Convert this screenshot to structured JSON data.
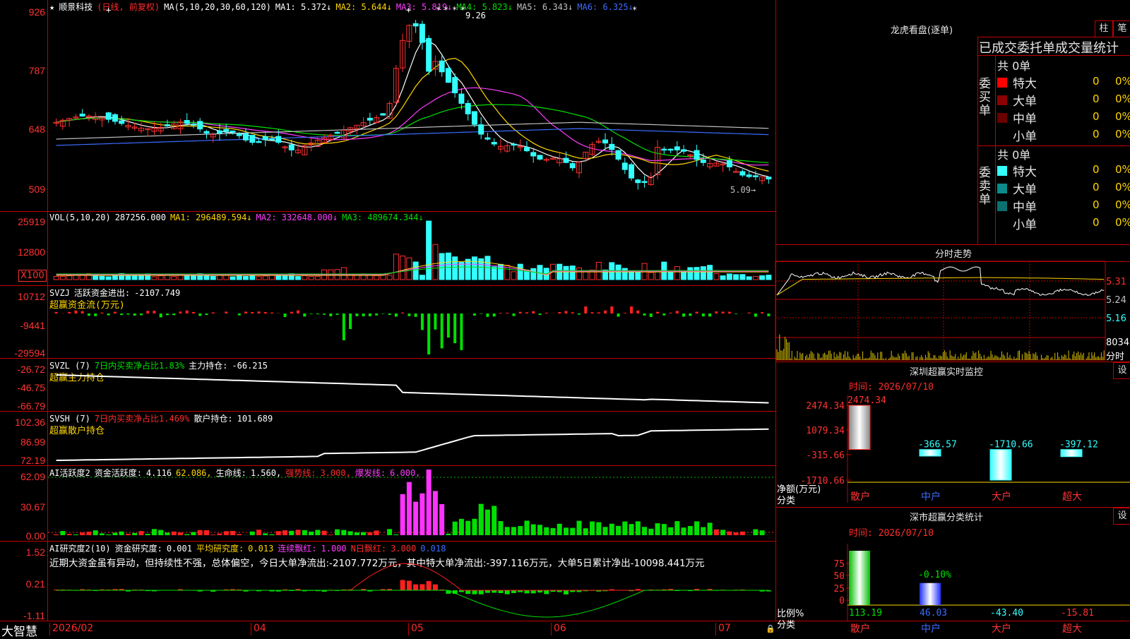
{
  "stock": {
    "name": "顺景科技",
    "period": "(日线, 前复权)",
    "ma_label": "MA(5,10,20,30,60,120)",
    "ma": [
      {
        "label": "MA1:",
        "value": "5.372",
        "arrow": "↓",
        "color": "#ffffff"
      },
      {
        "label": "MA2:",
        "value": "5.644",
        "arrow": "↓",
        "color": "#ffd700"
      },
      {
        "label": "MA3:",
        "value": "5.819",
        "arrow": "↓",
        "color": "#ff3cff"
      },
      {
        "label": "MA4:",
        "value": "5.823",
        "arrow": "↓",
        "color": "#00e000"
      },
      {
        "label": "MA5:",
        "value": "6.343",
        "arrow": "↓",
        "color": "#c0c0c0"
      },
      {
        "label": "MA6:",
        "value": "6.325",
        "arrow": "↓",
        "color": "#3b6cff"
      }
    ],
    "price_axis": [
      "926",
      "787",
      "648",
      "509"
    ],
    "high_label": "9.26",
    "low_label": "5.09"
  },
  "vol": {
    "label": "VOL(5,10,20)",
    "value": "287256.000",
    "ma": [
      {
        "label": "MA1:",
        "value": "296489.594",
        "arrow": "↓",
        "color": "#ffd700"
      },
      {
        "label": "MA2:",
        "value": "332648.000",
        "arrow": "↓",
        "color": "#ff3cff"
      },
      {
        "label": "MA3:",
        "value": "489674.344",
        "arrow": "↓",
        "color": "#00e000"
      }
    ],
    "axis": [
      "25919",
      "12800"
    ],
    "unit": "X100"
  },
  "svzj": {
    "label": "SVZJ",
    "desc": "活跃资金进出:",
    "value": "-2107.749",
    "sub": "超赢资金流(万元)",
    "axis": [
      "10712",
      "-9441",
      "-29594"
    ]
  },
  "svzl": {
    "label": "SVZL (7)",
    "desc": "7日内买卖净占比1.83%",
    "desc2": "主力持仓:",
    "value": "-66.215",
    "sub": "超赢主力持仓",
    "axis": [
      "-26.72",
      "-46.75",
      "-66.79"
    ]
  },
  "svsh": {
    "label": "SVSH (7)",
    "desc": "7日内买卖净占比1.469%",
    "desc2": "散户持仓:",
    "value": "101.689",
    "sub": "超赢散户持仓",
    "axis": [
      "102.36",
      "86.99",
      "72.19"
    ]
  },
  "ai_act": {
    "label": "AI活跃度2",
    "d1": "资金活跃度:",
    "v1": "4.116",
    "v2": "62.086,",
    "d3": "生命线:",
    "v3": "1.560,",
    "d4": "强势线:",
    "v4": "3.000,",
    "d5": "爆发线:",
    "v5": "6.000,",
    "axis": [
      "62.09",
      "30.67",
      "0.00"
    ]
  },
  "ai_res": {
    "label": "AI研究度2(10)",
    "d1": "资金研究度:",
    "v1": "0.001",
    "d2": "平均研究度:",
    "v2": "0.013",
    "d3": "连续飘红:",
    "v3": "1.000",
    "d4": "N日飘红:",
    "v4": "3.000",
    "v5": "0.018",
    "comment": "近期大资金虽有异动，但持续性不强，总体偏空，今日大单净流出:-2107.772万元，其中特大单净流出:-397.116万元，大单5日累计净出-10098.441万元",
    "axis": [
      "1.52",
      "0.21",
      "-1.11"
    ]
  },
  "xaxis": {
    "brand": "大智慧",
    "labels": [
      "2026/02",
      "04",
      "05",
      "06",
      "07"
    ]
  },
  "right": {
    "lhb_title": "龙虎看盘(逐单)",
    "btn_zhu": "柱",
    "btn_bi": "笔",
    "stat_title": "已成交委托单成交量统计",
    "buy_side": "委买单",
    "sell_side": "委卖单",
    "buy_total": "共 0单",
    "sell_total": "共 0单",
    "buy_rows": [
      {
        "name": "特大",
        "vol": "0",
        "pct": "0%",
        "color": "#ff0000"
      },
      {
        "name": "大单",
        "vol": "0",
        "pct": "0%",
        "color": "#8b0000"
      },
      {
        "name": "中单",
        "vol": "0",
        "pct": "0%",
        "color": "#6b0000"
      },
      {
        "name": "小单",
        "vol": "0",
        "pct": "0%",
        "color": ""
      }
    ],
    "sell_rows": [
      {
        "name": "特大",
        "vol": "0",
        "pct": "0%",
        "color": "#33ffff"
      },
      {
        "name": "大单",
        "vol": "0",
        "pct": "0%",
        "color": "#0b8b8b"
      },
      {
        "name": "中单",
        "vol": "0",
        "pct": "0%",
        "color": "#0b7070"
      },
      {
        "name": "小单",
        "vol": "0",
        "pct": "0%",
        "color": ""
      }
    ],
    "intraday_title": "分时走势",
    "intraday_axis": [
      "5.31",
      "5.24",
      "5.16"
    ],
    "intraday_vol": "8034",
    "intraday_unit": "分时",
    "sz_title": "深圳超赢实时监控",
    "sz_btn": "设",
    "sz_time": "时间: 2026/07/10",
    "sz_axis": [
      "2474.34",
      "1079.34",
      "-315.66",
      "-1710.66"
    ],
    "sz_unit": "净额(万元)",
    "sz_cat_label": "分类",
    "sz_bars": [
      {
        "cat": "散户",
        "value": 2474.34,
        "label": "2474.34"
      },
      {
        "cat": "中户",
        "value": -366.57,
        "label": "-366.57"
      },
      {
        "cat": "大户",
        "value": -1710.66,
        "label": "-1710.66"
      },
      {
        "cat": "超大",
        "value": -397.12,
        "label": "-397.12"
      }
    ],
    "cls_title": "深市超赢分类统计",
    "cls_btn": "设",
    "cls_time": "时间: 2026/07/10",
    "cls_axis": [
      "75",
      "50",
      "25",
      "0"
    ],
    "cls_unit": "比例%",
    "cls_cat_label": "分类",
    "cls_top_label": "-0.10%",
    "cls_bars": [
      {
        "cat": "散户",
        "value": 113.19,
        "label": "113.19"
      },
      {
        "cat": "中户",
        "value": 46.03,
        "label": "46.03"
      },
      {
        "cat": "大户",
        "value": -43.4,
        "label": "-43.40"
      },
      {
        "cat": "超大",
        "value": -15.81,
        "label": "-15.81"
      }
    ]
  }
}
